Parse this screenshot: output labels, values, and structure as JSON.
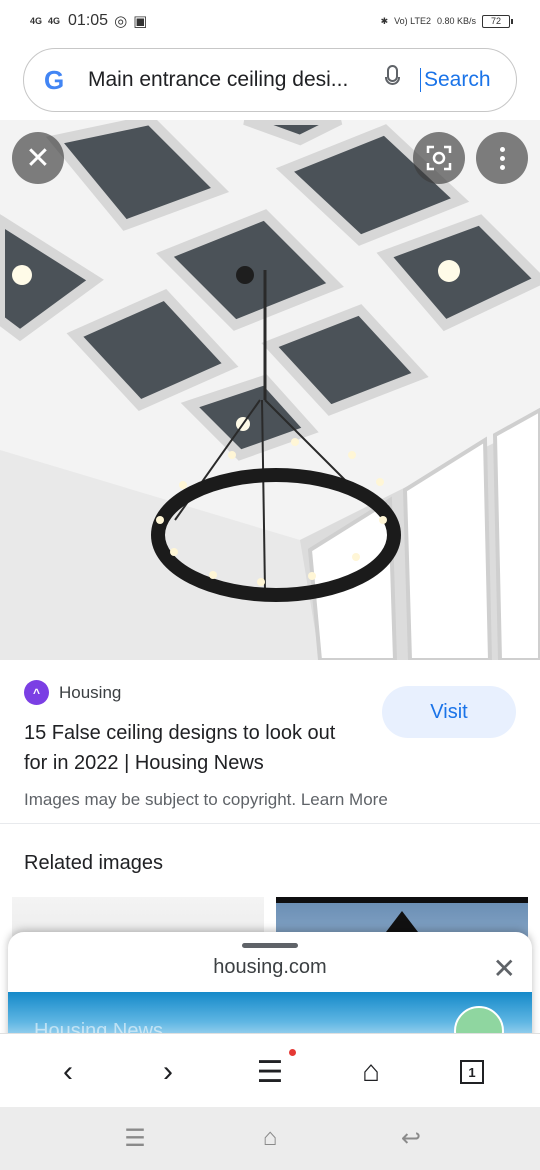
{
  "status": {
    "network1": "4G",
    "network2": "4G",
    "time": "01:05",
    "volte": "Vo) LTE2",
    "speed": "0.80 KB/s",
    "battery": "72"
  },
  "search": {
    "logo": "G",
    "query": "Main entrance ceiling desi...",
    "button": "Search"
  },
  "image_controls": {
    "close_glyph": "✕"
  },
  "result": {
    "source_icon": "^",
    "source": "Housing",
    "title": "15 False ceiling designs to look out for in 2022 | Housing News",
    "visit_label": "Visit",
    "copyright": "Images may be subject to copyright. Learn More"
  },
  "related": {
    "title": "Related images"
  },
  "sheet": {
    "url": "housing.com",
    "close_glyph": "✕",
    "preview_text": "Housing News"
  },
  "nav": {
    "back": "‹",
    "forward": "›",
    "menu": "☰",
    "home": "⌂",
    "tabs_count": "1"
  },
  "system": {
    "menu": "☰",
    "home": "⌂",
    "back": "↩"
  },
  "colors": {
    "accent": "#1a73e8",
    "visit_bg": "#e8f0fe",
    "source_icon_bg": "#7b3fe4",
    "notification_dot": "#e53935"
  }
}
